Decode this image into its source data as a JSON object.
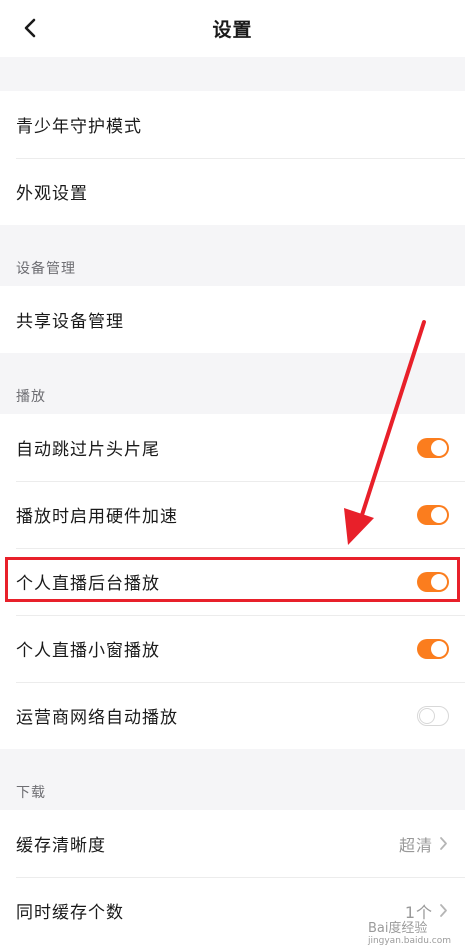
{
  "header": {
    "title": "设置"
  },
  "general": {
    "items": [
      {
        "label": "青少年守护模式"
      },
      {
        "label": "外观设置"
      }
    ]
  },
  "device": {
    "header": "设备管理",
    "items": [
      {
        "label": "共享设备管理"
      }
    ]
  },
  "playback": {
    "header": "播放",
    "items": [
      {
        "label": "自动跳过片头片尾",
        "enabled": true
      },
      {
        "label": "播放时启用硬件加速",
        "enabled": true
      },
      {
        "label": "个人直播后台播放",
        "enabled": true,
        "highlighted": true
      },
      {
        "label": "个人直播小窗播放",
        "enabled": true
      },
      {
        "label": "运营商网络自动播放",
        "enabled": false
      }
    ]
  },
  "download": {
    "header": "下载",
    "items": [
      {
        "label": "缓存清晰度",
        "value": "超清"
      },
      {
        "label": "同时缓存个数",
        "value": "1个"
      }
    ]
  },
  "colors": {
    "accent": "#fb7d1e",
    "highlight_box": "#e8202a",
    "background": "#f5f5f7"
  },
  "watermark": {
    "text": "Bai度经验",
    "sub": "jingyan.baidu.com"
  }
}
